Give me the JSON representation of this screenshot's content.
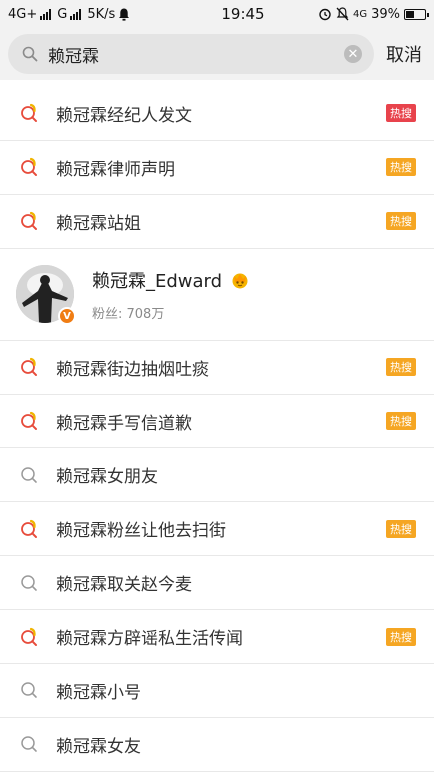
{
  "status_bar": {
    "network1": "4G+",
    "network2": "G",
    "speed": "5K/s",
    "time": "19:45",
    "network_right": "4G",
    "battery": "39%"
  },
  "search": {
    "query": "赖冠霖",
    "cancel_label": "取消"
  },
  "colors": {
    "hot_red": "#e8434c",
    "hot_orange": "#f5a623",
    "icon_red": "#e74c3c",
    "icon_yellow": "#f0b400",
    "icon_gray": "#9a9a9a"
  },
  "suggestions_top": [
    {
      "text": "赖冠霖经纪人发文",
      "badge": "热搜",
      "badge_color": "red",
      "icon": "hot-search-icon"
    },
    {
      "text": "赖冠霖律师声明",
      "badge": "热搜",
      "badge_color": "orange",
      "icon": "hot-search-icon"
    },
    {
      "text": "赖冠霖站姐",
      "badge": "热搜",
      "badge_color": "orange",
      "icon": "hot-search-icon"
    }
  ],
  "user": {
    "name": "赖冠霖_Edward",
    "fans": "粉丝: 708万",
    "verified": "V"
  },
  "suggestions_bottom": [
    {
      "text": "赖冠霖街边抽烟吐痰",
      "badge": "热搜",
      "badge_color": "orange",
      "icon": "hot-search-icon"
    },
    {
      "text": "赖冠霖手写信道歉",
      "badge": "热搜",
      "badge_color": "orange",
      "icon": "hot-search-icon"
    },
    {
      "text": "赖冠霖女朋友",
      "badge": "",
      "badge_color": "",
      "icon": "search-icon"
    },
    {
      "text": "赖冠霖粉丝让他去扫街",
      "badge": "热搜",
      "badge_color": "orange",
      "icon": "hot-search-icon"
    },
    {
      "text": "赖冠霖取关赵今麦",
      "badge": "",
      "badge_color": "",
      "icon": "search-icon"
    },
    {
      "text": "赖冠霖方辟谣私生活传闻",
      "badge": "热搜",
      "badge_color": "orange",
      "icon": "hot-search-icon"
    },
    {
      "text": "赖冠霖小号",
      "badge": "",
      "badge_color": "",
      "icon": "search-icon"
    },
    {
      "text": "赖冠霖女友",
      "badge": "",
      "badge_color": "",
      "icon": "search-icon"
    }
  ]
}
